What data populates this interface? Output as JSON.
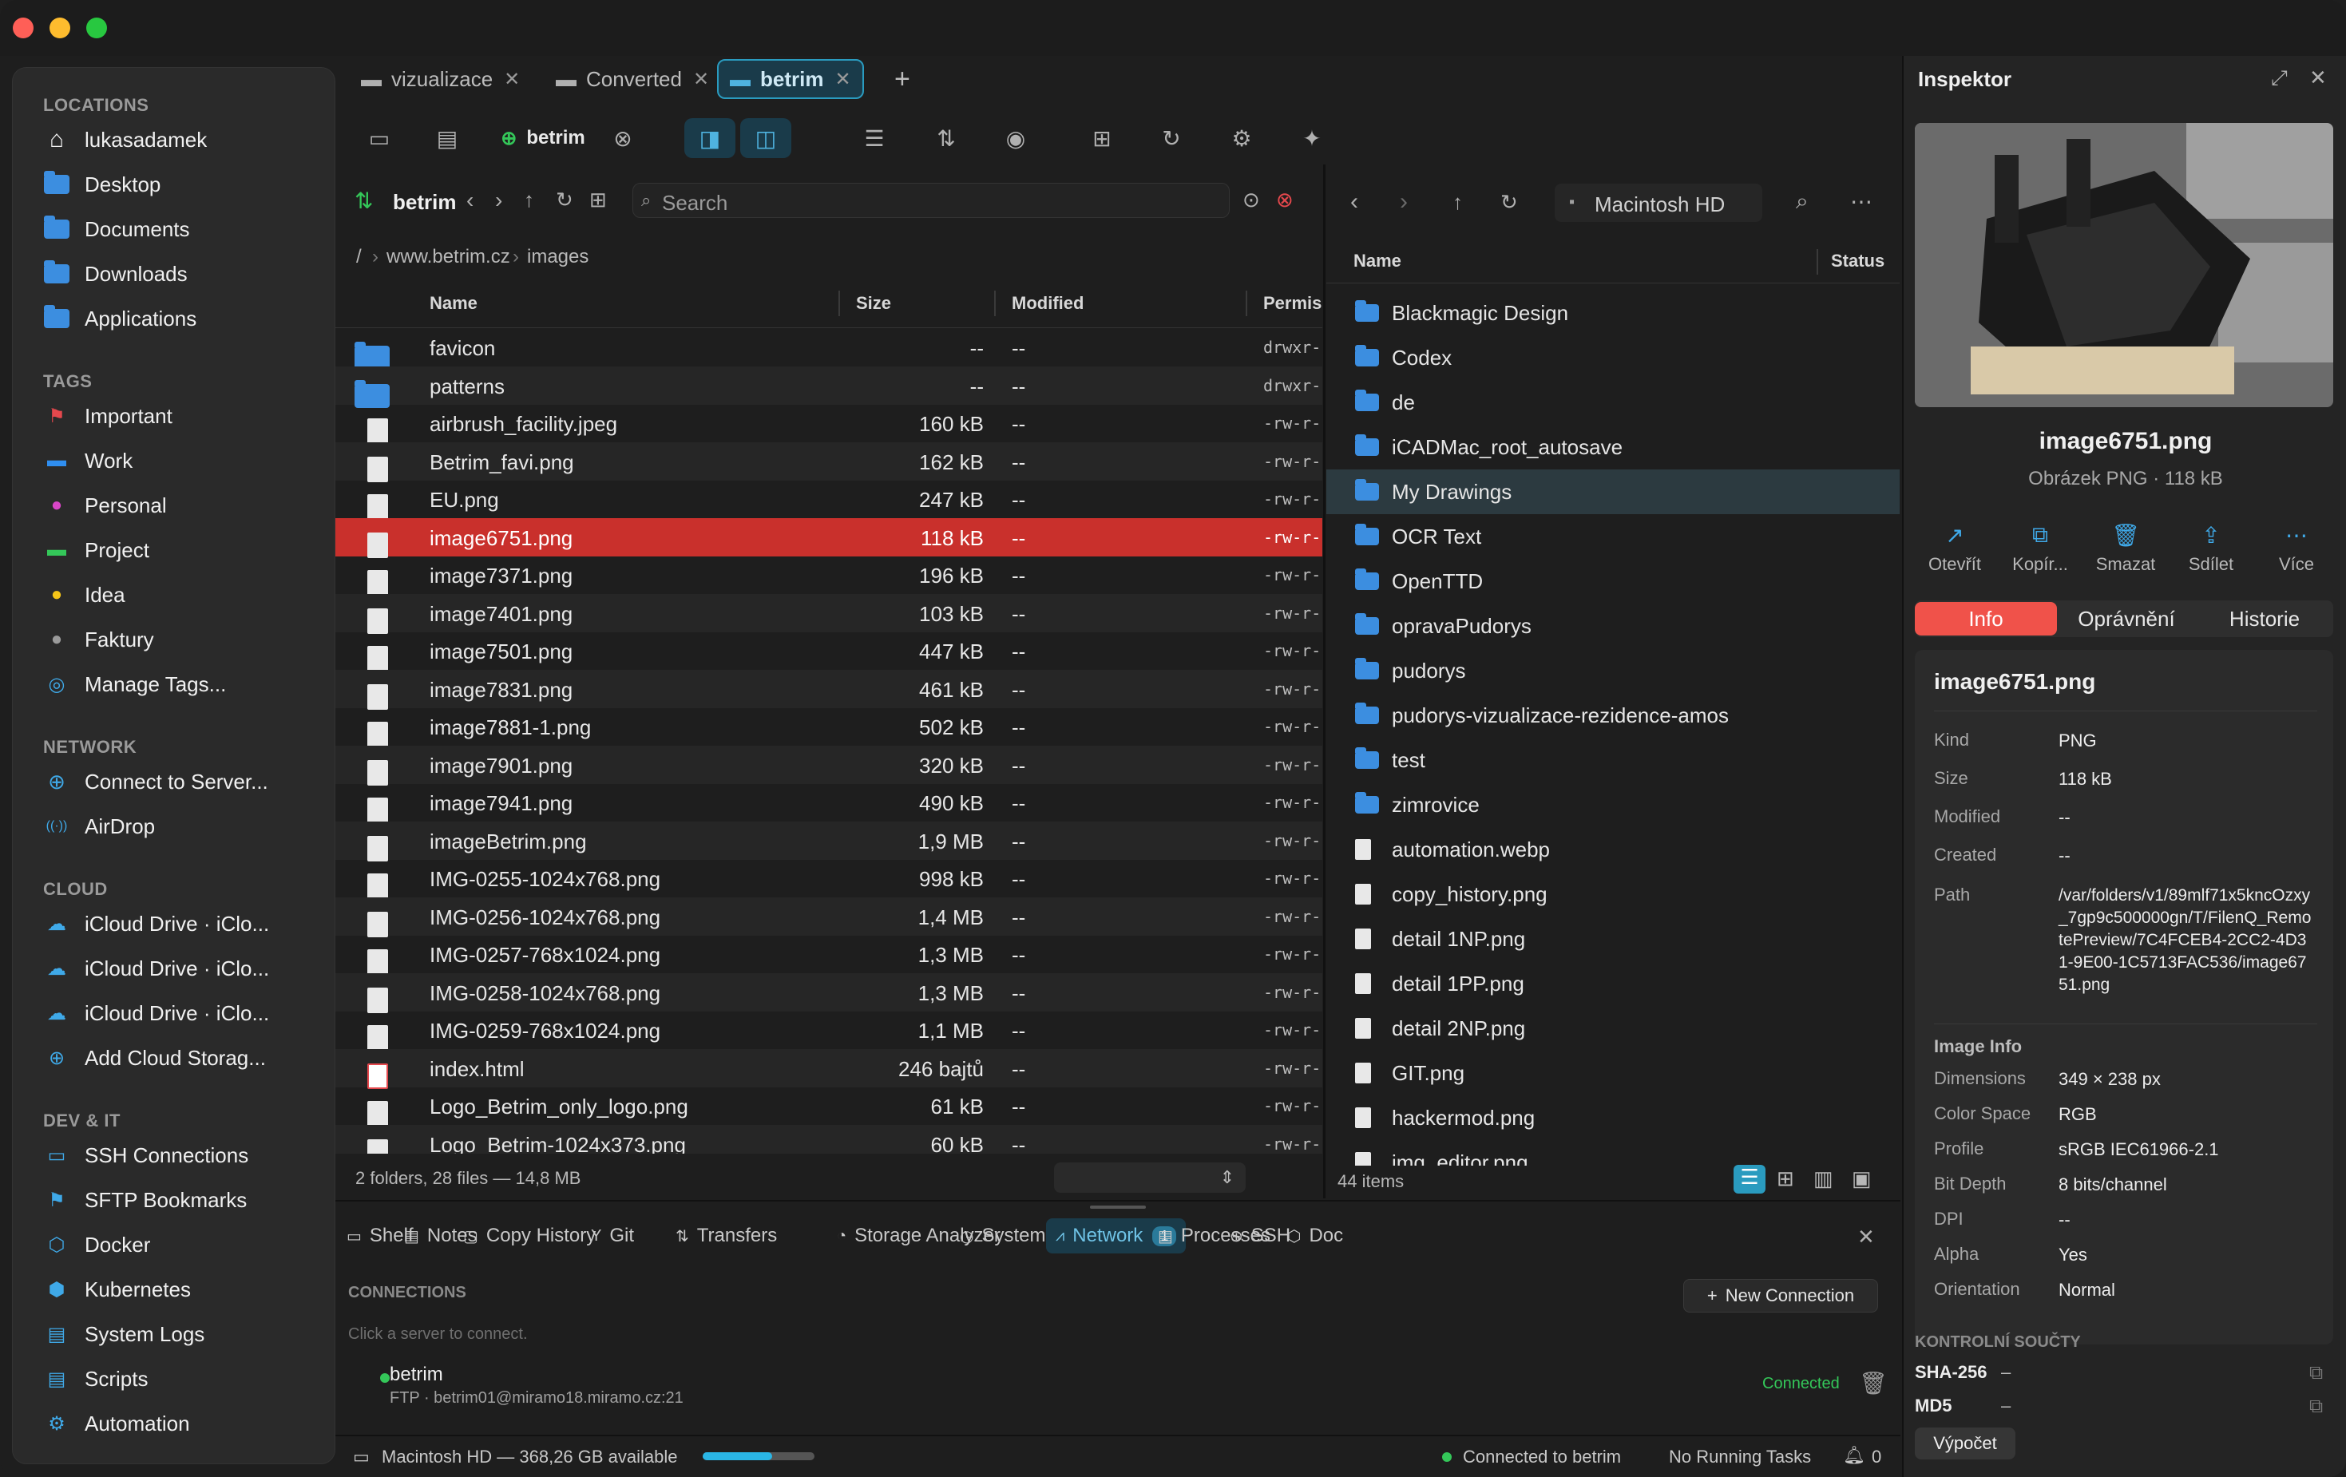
{
  "sidebar": {
    "locations_header": "LOCATIONS",
    "locations": [
      "lukasadamek",
      "Desktop",
      "Documents",
      "Downloads",
      "Applications"
    ],
    "tags_header": "TAGS",
    "tags": [
      {
        "label": "Important",
        "color": "#e5484d"
      },
      {
        "label": "Work",
        "color": "#2f8ef0"
      },
      {
        "label": "Personal",
        "color": "#d946c8"
      },
      {
        "label": "Project",
        "color": "#34c759"
      },
      {
        "label": "Idea",
        "color": "#f5c518"
      },
      {
        "label": "Faktury",
        "color": "#9a9a9a"
      },
      {
        "label": "Manage Tags...",
        "color": "#3fa9e8"
      }
    ],
    "network_header": "NETWORK",
    "network": [
      "Connect to Server...",
      "AirDrop"
    ],
    "cloud_header": "CLOUD",
    "cloud": [
      "iCloud Drive · iClo...",
      "iCloud Drive · iClo...",
      "iCloud Drive · iClo...",
      "Add Cloud Storag..."
    ],
    "devit_header": "DEV & IT",
    "devit": [
      "SSH Connections",
      "SFTP Bookmarks",
      "Docker",
      "Kubernetes",
      "System Logs",
      "Scripts",
      "Automation"
    ]
  },
  "tabs": [
    {
      "label": "vizualizace"
    },
    {
      "label": "Converted"
    },
    {
      "label": "betrim"
    }
  ],
  "toolbar": {
    "server_label": "betrim"
  },
  "left_pane": {
    "title": "betrim",
    "search_placeholder": "Search",
    "breadcrumb": [
      "/",
      "www.betrim.cz",
      "images"
    ],
    "columns": [
      "Name",
      "Size",
      "Modified",
      "Permis"
    ],
    "rows": [
      {
        "name": "favicon",
        "size": "--",
        "modified": "--",
        "perm": "drwxr-",
        "type": "folder"
      },
      {
        "name": "patterns",
        "size": "--",
        "modified": "--",
        "perm": "drwxr-",
        "type": "folder"
      },
      {
        "name": "airbrush_facility.jpeg",
        "size": "160 kB",
        "modified": "--",
        "perm": "-rw-r-",
        "type": "file"
      },
      {
        "name": "Betrim_favi.png",
        "size": "162 kB",
        "modified": "--",
        "perm": "-rw-r-",
        "type": "file"
      },
      {
        "name": "EU.png",
        "size": "247 kB",
        "modified": "--",
        "perm": "-rw-r-",
        "type": "file"
      },
      {
        "name": "image6751.png",
        "size": "118 kB",
        "modified": "--",
        "perm": "-rw-r-",
        "type": "file"
      },
      {
        "name": "image7371.png",
        "size": "196 kB",
        "modified": "--",
        "perm": "-rw-r-",
        "type": "file"
      },
      {
        "name": "image7401.png",
        "size": "103 kB",
        "modified": "--",
        "perm": "-rw-r-",
        "type": "file"
      },
      {
        "name": "image7501.png",
        "size": "447 kB",
        "modified": "--",
        "perm": "-rw-r-",
        "type": "file"
      },
      {
        "name": "image7831.png",
        "size": "461 kB",
        "modified": "--",
        "perm": "-rw-r-",
        "type": "file"
      },
      {
        "name": "image7881-1.png",
        "size": "502 kB",
        "modified": "--",
        "perm": "-rw-r-",
        "type": "file"
      },
      {
        "name": "image7901.png",
        "size": "320 kB",
        "modified": "--",
        "perm": "-rw-r-",
        "type": "file"
      },
      {
        "name": "image7941.png",
        "size": "490 kB",
        "modified": "--",
        "perm": "-rw-r-",
        "type": "file"
      },
      {
        "name": "imageBetrim.png",
        "size": "1,9 MB",
        "modified": "--",
        "perm": "-rw-r-",
        "type": "file"
      },
      {
        "name": "IMG-0255-1024x768.png",
        "size": "998 kB",
        "modified": "--",
        "perm": "-rw-r-",
        "type": "file"
      },
      {
        "name": "IMG-0256-1024x768.png",
        "size": "1,4 MB",
        "modified": "--",
        "perm": "-rw-r-",
        "type": "file"
      },
      {
        "name": "IMG-0257-768x1024.png",
        "size": "1,3 MB",
        "modified": "--",
        "perm": "-rw-r-",
        "type": "file"
      },
      {
        "name": "IMG-0258-1024x768.png",
        "size": "1,3 MB",
        "modified": "--",
        "perm": "-rw-r-",
        "type": "file"
      },
      {
        "name": "IMG-0259-768x1024.png",
        "size": "1,1 MB",
        "modified": "--",
        "perm": "-rw-r-",
        "type": "file"
      },
      {
        "name": "index.html",
        "size": "246 bajtů",
        "modified": "--",
        "perm": "-rw-r-",
        "type": "html"
      },
      {
        "name": "Logo_Betrim_only_logo.png",
        "size": "61 kB",
        "modified": "--",
        "perm": "-rw-r-",
        "type": "file"
      },
      {
        "name": "Logo_Betrim-1024x373.png",
        "size": "60 kB",
        "modified": "--",
        "perm": "-rw-r-",
        "type": "file"
      }
    ],
    "footer": "2 folders, 28 files — 14,8 MB"
  },
  "right_pane": {
    "location": "Macintosh HD",
    "columns": [
      "Name",
      "Status"
    ],
    "rows": [
      {
        "name": "Blackmagic Design",
        "type": "folder"
      },
      {
        "name": "Codex",
        "type": "folder"
      },
      {
        "name": "de",
        "type": "folder"
      },
      {
        "name": "iCADMac_root_autosave",
        "type": "folder"
      },
      {
        "name": "My Drawings",
        "type": "folder"
      },
      {
        "name": "OCR Text",
        "type": "folder"
      },
      {
        "name": "OpenTTD",
        "type": "folder"
      },
      {
        "name": "opravaPudorys",
        "type": "folder"
      },
      {
        "name": "pudorys",
        "type": "folder"
      },
      {
        "name": "pudorys-vizualizace-rezidence-amos",
        "type": "folder"
      },
      {
        "name": "test",
        "type": "folder"
      },
      {
        "name": "zimrovice",
        "type": "folder"
      },
      {
        "name": "automation.webp",
        "type": "file"
      },
      {
        "name": "copy_history.png",
        "type": "file"
      },
      {
        "name": "detail 1NP.png",
        "type": "file"
      },
      {
        "name": "detail 1PP.png",
        "type": "file"
      },
      {
        "name": "detail 2NP.png",
        "type": "file"
      },
      {
        "name": "GIT.png",
        "type": "file"
      },
      {
        "name": "hackermod.png",
        "type": "file"
      },
      {
        "name": "img_editor.png",
        "type": "file"
      }
    ],
    "footer": "44 items"
  },
  "bottom_panel": {
    "tabs": [
      "Shelf",
      "Notes",
      "Copy History",
      "Git",
      "Transfers",
      "Storage Analyzer",
      "System",
      "Network",
      "Processes",
      "SSH",
      "Doc"
    ],
    "network_badge": "1",
    "connections_header": "CONNECTIONS",
    "new_connection": "New Connection",
    "hint": "Click a server to connect.",
    "connection": {
      "name": "betrim",
      "detail": "FTP · betrim01@miramo18.miramo.cz:21",
      "status": "Connected"
    }
  },
  "statusbar": {
    "disk": "Macintosh HD — 368,26 GB available",
    "disk_used_fraction": 0.62,
    "connected": "Connected to betrim",
    "tasks": "No Running Tasks",
    "notifications": "0"
  },
  "inspector": {
    "title": "Inspektor",
    "filename": "image6751.png",
    "subtitle": "Obrázek PNG · 118 kB",
    "actions": [
      "Otevřít",
      "Kopír...",
      "Smazat",
      "Sdílet",
      "Více"
    ],
    "segments": [
      "Info",
      "Oprávnění",
      "Historie"
    ],
    "info_title": "image6751.png",
    "props": [
      {
        "k": "Kind",
        "v": "PNG"
      },
      {
        "k": "Size",
        "v": "118 kB"
      },
      {
        "k": "Modified",
        "v": "--"
      },
      {
        "k": "Created",
        "v": "--"
      }
    ],
    "path_label": "Path",
    "path_value": "/var/folders/v1/89mlf71x5kncOzxy_7gp9c500000gn/T/FilenQ_RemotePreview/7C4FCEB4-2CC2-4D31-9E00-1C5713FAC536/image6751.png",
    "image_info_header": "Image Info",
    "image_info": [
      {
        "k": "Dimensions",
        "v": "349 × 238 px"
      },
      {
        "k": "Color Space",
        "v": "RGB"
      },
      {
        "k": "Profile",
        "v": "sRGB IEC61966-2.1"
      },
      {
        "k": "Bit Depth",
        "v": "8 bits/channel"
      },
      {
        "k": "DPI",
        "v": "--"
      },
      {
        "k": "Alpha",
        "v": "Yes"
      },
      {
        "k": "Orientation",
        "v": "Normal"
      }
    ],
    "checksums_header": "KONTROLNÍ SOUČTY",
    "checksums": [
      {
        "k": "SHA-256",
        "v": "–"
      },
      {
        "k": "MD5",
        "v": "–"
      }
    ],
    "compute_button": "Výpočet"
  }
}
